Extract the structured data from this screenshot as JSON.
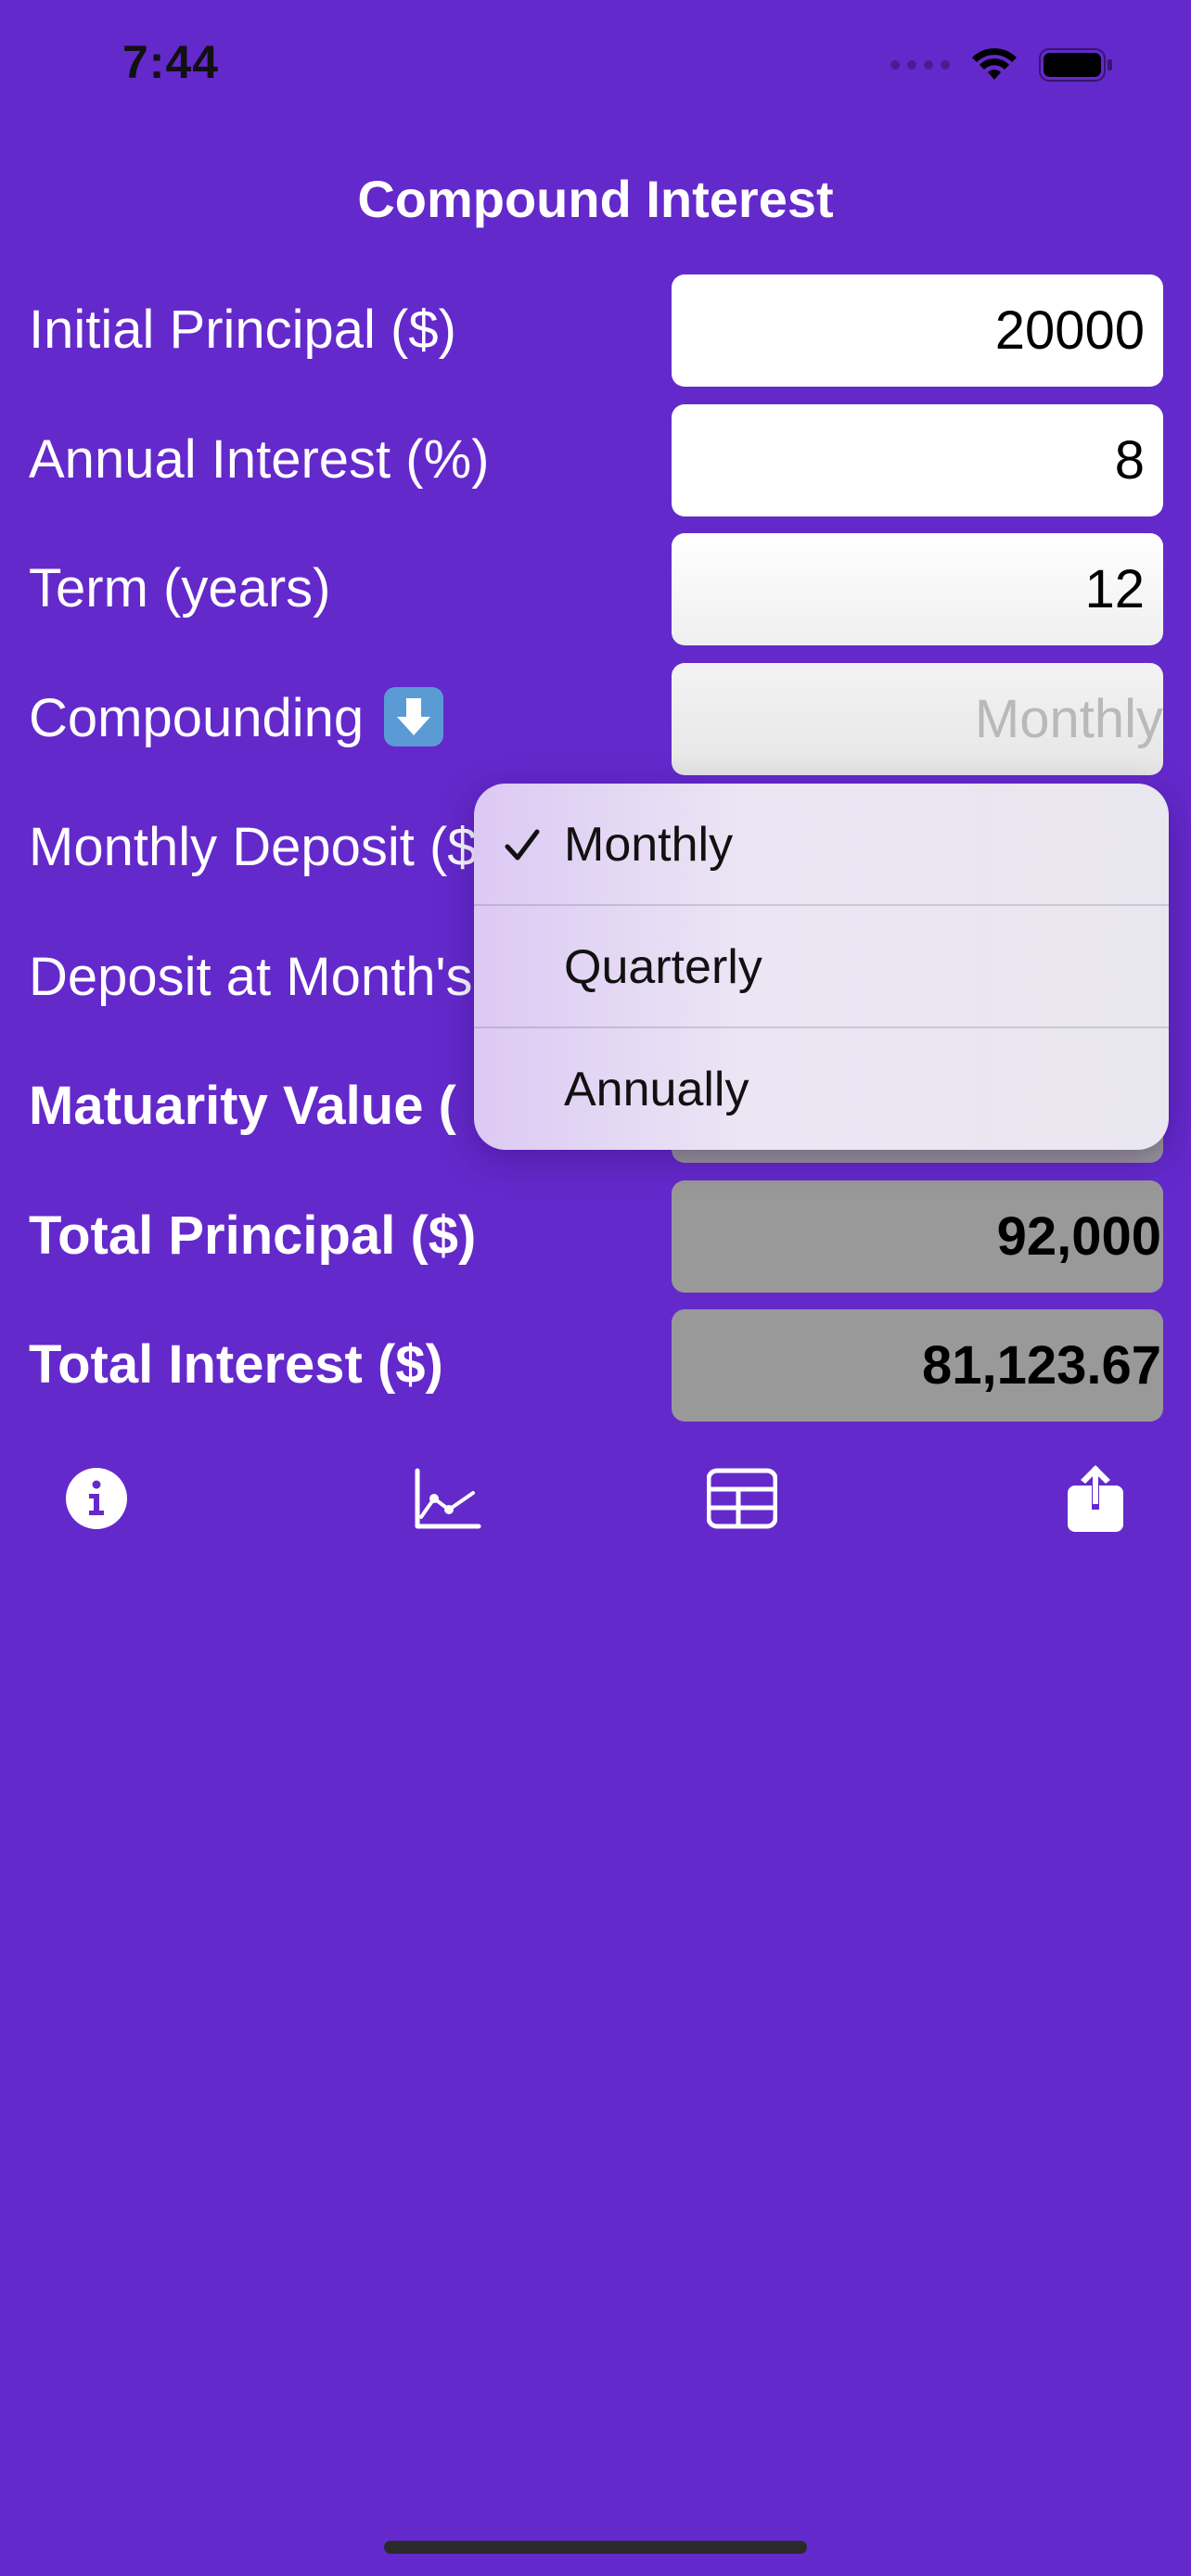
{
  "status_bar": {
    "time": "7:44"
  },
  "app": {
    "title": "Compound Interest"
  },
  "rows": [
    {
      "label": "Initial Principal ($)",
      "value": "20000"
    },
    {
      "label": "Annual Interest (%)",
      "value": "8"
    },
    {
      "label": "Term (years)",
      "value": "12"
    },
    {
      "label": "Compounding",
      "value": "Monthly"
    },
    {
      "label": "Monthly Deposit ($"
    },
    {
      "label": "Deposit at Month's"
    },
    {
      "label": "Matuarity Value ("
    },
    {
      "label": "Total Principal ($)",
      "value": "92,000"
    },
    {
      "label": "Total Interest ($)",
      "value": "81,123.67"
    }
  ],
  "compounding_menu": {
    "options": [
      "Monthly",
      "Quarterly",
      "Annually"
    ],
    "selected": "Monthly"
  },
  "toolbar": {
    "icons": [
      "info-icon",
      "line-chart-icon",
      "table-icon",
      "share-icon"
    ]
  },
  "colors": {
    "background": "#6429CB",
    "result_field": "#999999"
  }
}
